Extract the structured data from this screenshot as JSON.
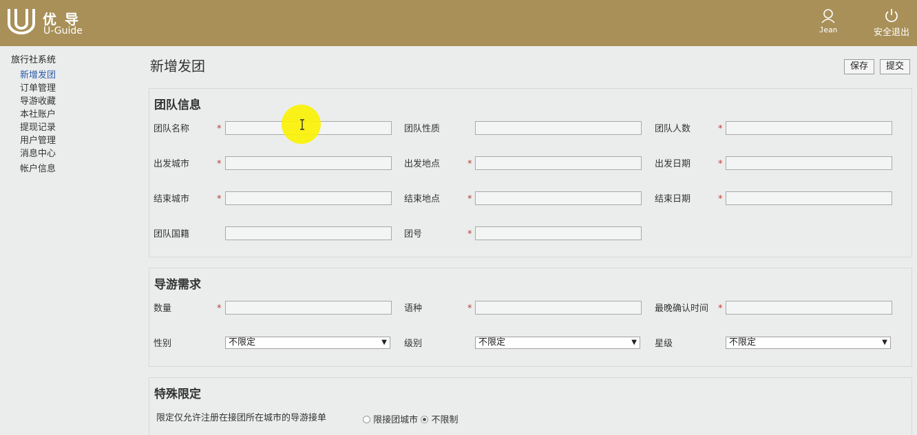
{
  "header": {
    "brand_cn": "优导",
    "brand_en": "U-Guide",
    "user_name": "Jean",
    "logout_label": "安全退出"
  },
  "sidebar": {
    "title": "旅行社系统",
    "items": [
      {
        "label": "新增发团"
      },
      {
        "label": "订单管理"
      },
      {
        "label": "导游收藏"
      },
      {
        "label": "本社账户"
      },
      {
        "label": "提现记录"
      },
      {
        "label": "用户管理"
      },
      {
        "label": "消息中心"
      },
      {
        "label": "帐户信息"
      }
    ]
  },
  "page": {
    "title": "新增发团",
    "save_label": "保存",
    "submit_label": "提交"
  },
  "team_info": {
    "title": "团队信息",
    "fields": [
      {
        "label": "团队名称",
        "required": "*",
        "value": ""
      },
      {
        "label": "团队性质",
        "required": "",
        "value": ""
      },
      {
        "label": "团队人数",
        "required": "*",
        "value": ""
      },
      {
        "label": "出发城市",
        "required": "*",
        "value": ""
      },
      {
        "label": "出发地点",
        "required": "*",
        "value": ""
      },
      {
        "label": "出发日期",
        "required": "*",
        "value": ""
      },
      {
        "label": "结束城市",
        "required": "*",
        "value": ""
      },
      {
        "label": "结束地点",
        "required": "*",
        "value": ""
      },
      {
        "label": "结束日期",
        "required": "*",
        "value": ""
      },
      {
        "label": "团队国籍",
        "required": "",
        "value": ""
      },
      {
        "label": "团号",
        "required": "*",
        "value": ""
      }
    ]
  },
  "guide_req": {
    "title": "导游需求",
    "fields": [
      {
        "label": "数量",
        "required": "*",
        "value": ""
      },
      {
        "label": "语种",
        "required": "*",
        "value": ""
      },
      {
        "label": "最晚确认时间",
        "required": "*",
        "value": ""
      }
    ],
    "selects": [
      {
        "label": "性别",
        "value": "不限定"
      },
      {
        "label": "级别",
        "value": "不限定"
      },
      {
        "label": "星级",
        "value": "不限定"
      }
    ]
  },
  "special": {
    "title": "特殊限定",
    "description": "限定仅允许注册在接团所在城市的导游接单",
    "option_limit": "限接团城市",
    "option_unlimited": "不限制"
  },
  "colors": {
    "header_bg": "#a89058",
    "active_link": "#2a5ca8",
    "required": "#c0392b",
    "cursor_highlight": "#fbf200"
  }
}
